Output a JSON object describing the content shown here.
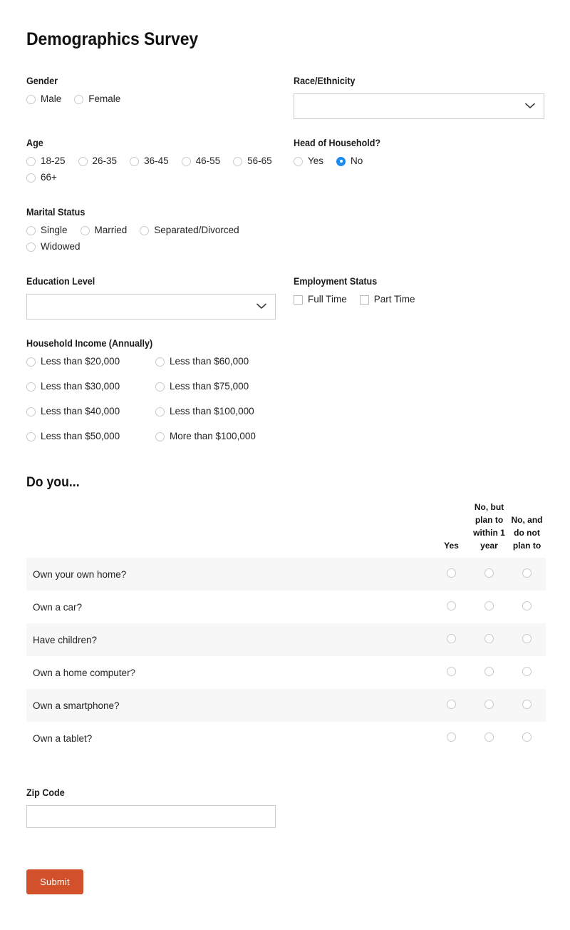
{
  "title": "Demographics Survey",
  "fields": {
    "gender": {
      "label": "Gender",
      "options": [
        {
          "label": "Male",
          "selected": false
        },
        {
          "label": "Female",
          "selected": false
        }
      ]
    },
    "race": {
      "label": "Race/Ethnicity",
      "value": "",
      "icon": "chevron-down-icon"
    },
    "age": {
      "label": "Age",
      "options": [
        {
          "label": "18-25",
          "selected": false
        },
        {
          "label": "26-35",
          "selected": false
        },
        {
          "label": "36-45",
          "selected": false
        },
        {
          "label": "46-55",
          "selected": false
        },
        {
          "label": "56-65",
          "selected": false
        },
        {
          "label": "66+",
          "selected": false
        }
      ]
    },
    "head_of_household": {
      "label": "Head of Household?",
      "options": [
        {
          "label": "Yes",
          "selected": false
        },
        {
          "label": "No",
          "selected": true
        }
      ]
    },
    "marital_status": {
      "label": "Marital Status",
      "options": [
        {
          "label": "Single",
          "selected": false
        },
        {
          "label": "Married",
          "selected": false
        },
        {
          "label": "Separated/Divorced",
          "selected": false
        },
        {
          "label": "Widowed",
          "selected": false
        }
      ]
    },
    "education": {
      "label": "Education Level",
      "value": "",
      "icon": "chevron-down-icon"
    },
    "employment": {
      "label": "Employment Status",
      "options": [
        {
          "label": "Full Time",
          "checked": false
        },
        {
          "label": "Part Time",
          "checked": false
        }
      ]
    },
    "income": {
      "label": "Household Income (Annually)",
      "options": [
        {
          "label": "Less than $20,000",
          "selected": false
        },
        {
          "label": "Less than $60,000",
          "selected": false
        },
        {
          "label": "Less than $30,000",
          "selected": false
        },
        {
          "label": "Less than $75,000",
          "selected": false
        },
        {
          "label": "Less than $40,000",
          "selected": false
        },
        {
          "label": "Less than $100,000",
          "selected": false
        },
        {
          "label": "Less than $50,000",
          "selected": false
        },
        {
          "label": "More than $100,000",
          "selected": false
        }
      ]
    },
    "zip": {
      "label": "Zip Code",
      "value": ""
    }
  },
  "matrix": {
    "title": "Do you...",
    "columns": [
      "Yes",
      "No, but plan to within 1 year",
      "No, and do not plan to"
    ],
    "rows": [
      {
        "question": "Own your own home?",
        "answer": null
      },
      {
        "question": "Own a car?",
        "answer": null
      },
      {
        "question": "Have children?",
        "answer": null
      },
      {
        "question": "Own a home computer?",
        "answer": null
      },
      {
        "question": "Own a smartphone?",
        "answer": null
      },
      {
        "question": "Own a tablet?",
        "answer": null
      }
    ]
  },
  "submit": {
    "label": "Submit"
  },
  "colors": {
    "accent": "#1a8bf0",
    "submit_background": "#d2512a",
    "stripe": "#f7f7f7",
    "border": "#cccccc"
  }
}
